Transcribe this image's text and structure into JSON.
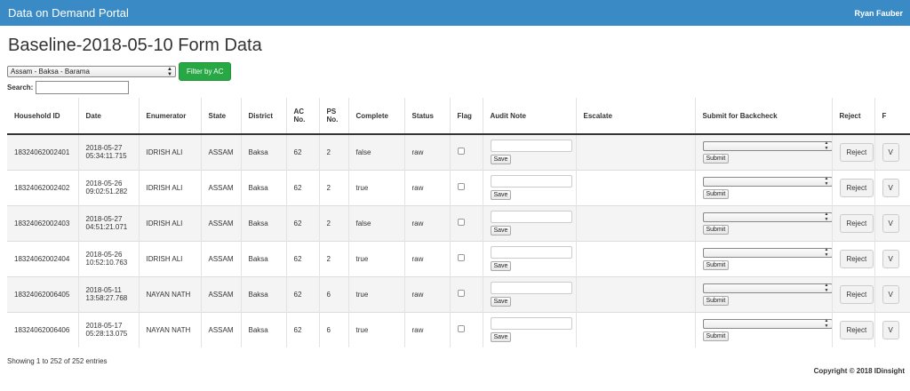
{
  "navbar": {
    "brand": "Data on Demand Portal",
    "user": "Ryan Fauber"
  },
  "page": {
    "title": "Baseline-2018-05-10 Form Data"
  },
  "filter": {
    "selected": "Assam - Baksa - Barama",
    "button": "Filter by AC"
  },
  "search": {
    "label": "Search:",
    "value": ""
  },
  "table": {
    "headers": [
      "Household ID",
      "Date",
      "Enumerator",
      "State",
      "District",
      "AC No.",
      "PS No.",
      "Complete",
      "Status",
      "Flag",
      "Audit Note",
      "Escalate",
      "Submit for Backcheck",
      "Reject",
      "F"
    ],
    "save_label": "Save",
    "submit_label": "Submit",
    "reject_label": "Reject",
    "view_label": "V",
    "rows": [
      {
        "household_id": "18324062002401",
        "date": "2018-05-27",
        "time": "05:34:11.715",
        "enumerator": "IDRISH ALI",
        "state": "ASSAM",
        "district": "Baksa",
        "ac_no": "62",
        "ps_no": "2",
        "complete": "false",
        "status": "raw"
      },
      {
        "household_id": "18324062002402",
        "date": "2018-05-26",
        "time": "09:02:51.282",
        "enumerator": "IDRISH ALI",
        "state": "ASSAM",
        "district": "Baksa",
        "ac_no": "62",
        "ps_no": "2",
        "complete": "true",
        "status": "raw"
      },
      {
        "household_id": "18324062002403",
        "date": "2018-05-27",
        "time": "04:51:21.071",
        "enumerator": "IDRISH ALI",
        "state": "ASSAM",
        "district": "Baksa",
        "ac_no": "62",
        "ps_no": "2",
        "complete": "false",
        "status": "raw"
      },
      {
        "household_id": "18324062002404",
        "date": "2018-05-26",
        "time": "10:52:10.763",
        "enumerator": "IDRISH ALI",
        "state": "ASSAM",
        "district": "Baksa",
        "ac_no": "62",
        "ps_no": "2",
        "complete": "true",
        "status": "raw"
      },
      {
        "household_id": "18324062006405",
        "date": "2018-05-11",
        "time": "13:58:27.768",
        "enumerator": "NAYAN NATH",
        "state": "ASSAM",
        "district": "Baksa",
        "ac_no": "62",
        "ps_no": "6",
        "complete": "true",
        "status": "raw"
      },
      {
        "household_id": "18324062006406",
        "date": "2018-05-17",
        "time": "05:28:13.075",
        "enumerator": "NAYAN NATH",
        "state": "ASSAM",
        "district": "Baksa",
        "ac_no": "62",
        "ps_no": "6",
        "complete": "true",
        "status": "raw"
      }
    ]
  },
  "info": {
    "text": "Showing 1 to 252 of 252 entries"
  },
  "footer": {
    "copyright": "Copyright © 2018 IDinsight"
  }
}
